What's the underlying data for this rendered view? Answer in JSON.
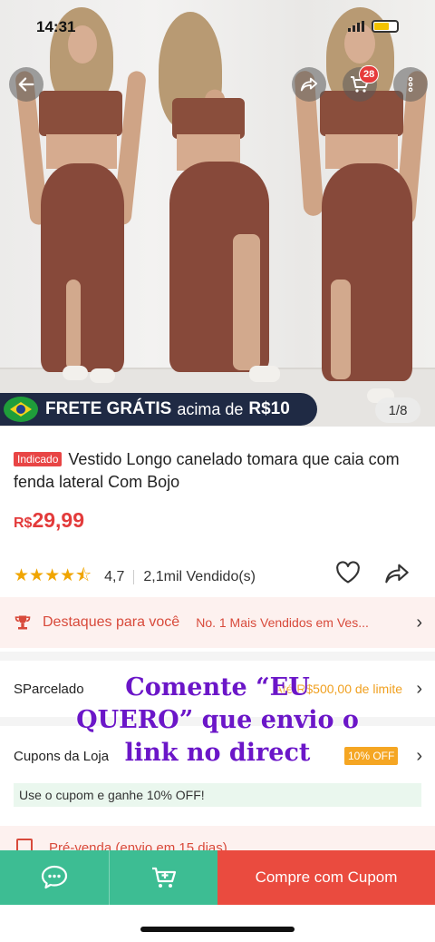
{
  "status_bar": {
    "time": "14:31"
  },
  "gallery": {
    "counter": "1/8",
    "cart_count": "28",
    "frete_banner": {
      "part1": "FRETE GRÁTIS",
      "part2": "acima de",
      "part3": "R$10"
    }
  },
  "product": {
    "tag": "Indicado",
    "title": "Vestido Longo canelado tomara que caia com fenda lateral Com Bojo",
    "price_currency": "R$",
    "price_value": "29,99",
    "rating": "4,7",
    "sold": "2,1mil Vendido(s)"
  },
  "destaques": {
    "label": "Destaques para você",
    "value": "No. 1 Mais Vendidos em Ves..."
  },
  "parcelado": {
    "label": "SParcelado",
    "value": "Até R$500,00 de limite"
  },
  "cupons": {
    "label": "Cupons da Loja",
    "badge": "10% OFF",
    "note": "Use o cupom e ganhe 10% OFF!"
  },
  "prevenda": {
    "label": "Pré-venda (envio em 15 dias)"
  },
  "overlay_text": "Comente “EU QUERO” que envio o link no direct",
  "bottom_bar": {
    "buy_label": "Compre com Cupom"
  },
  "colors": {
    "accent_red": "#ea4b3f",
    "green": "#3dbd93",
    "overlay_purple": "#6b16c8"
  }
}
